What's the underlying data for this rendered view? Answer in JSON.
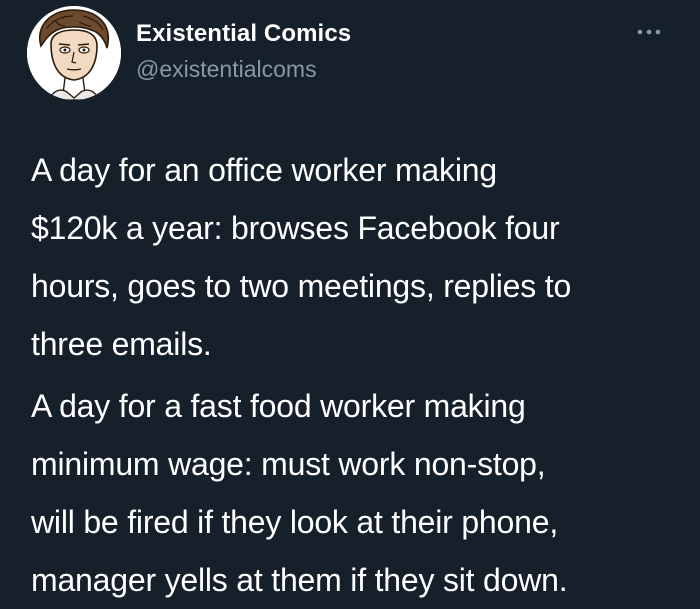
{
  "tweet": {
    "author": {
      "display_name": "Existential Comics",
      "handle": "@existentialcoms",
      "avatar_icon": "cartoon-portrait-avatar"
    },
    "more_icon": "more-options-icon",
    "paragraphs": [
      {
        "lines": [
          "A day for an office worker making",
          "$120k a year: browses Facebook four",
          "hours, goes to two meetings, replies to",
          "three emails."
        ]
      },
      {
        "lines": [
          "A day for a fast food worker making",
          "minimum wage: must work non-stop,",
          "will be fired if they look at their phone,",
          "manager yells at them if they sit down."
        ]
      }
    ]
  },
  "colors": {
    "background": "#15202b",
    "text_primary": "#ffffff",
    "text_secondary": "#8899a6"
  }
}
